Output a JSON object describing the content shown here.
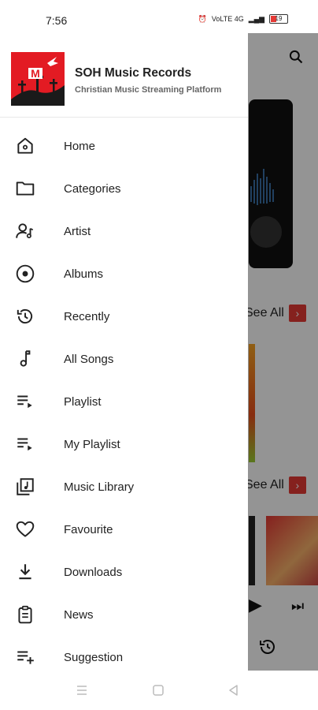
{
  "status_bar": {
    "time": "7:56",
    "network": "VoLTE 4G",
    "battery": "19"
  },
  "drawer": {
    "app_title": "SOH Music Records",
    "app_subtitle": "Christian Music Streaming Platform",
    "items": [
      {
        "label": "Home",
        "icon": "home-icon"
      },
      {
        "label": "Categories",
        "icon": "folder-icon"
      },
      {
        "label": "Artist",
        "icon": "artist-icon"
      },
      {
        "label": "Albums",
        "icon": "album-icon"
      },
      {
        "label": "Recently",
        "icon": "history-icon"
      },
      {
        "label": "All Songs",
        "icon": "music-note-icon"
      },
      {
        "label": "Playlist",
        "icon": "playlist-icon"
      },
      {
        "label": "My Playlist",
        "icon": "my-playlist-icon"
      },
      {
        "label": "Music Library",
        "icon": "music-library-icon"
      },
      {
        "label": "Favourite",
        "icon": "heart-icon"
      },
      {
        "label": "Downloads",
        "icon": "download-icon"
      },
      {
        "label": "News",
        "icon": "news-icon"
      },
      {
        "label": "Suggestion",
        "icon": "suggestion-icon"
      }
    ]
  },
  "background": {
    "see_all_1": "See All",
    "see_all_2": "See All"
  },
  "colors": {
    "accent": "#e31b23",
    "scrim": "rgba(0,0,0,0.42)"
  }
}
